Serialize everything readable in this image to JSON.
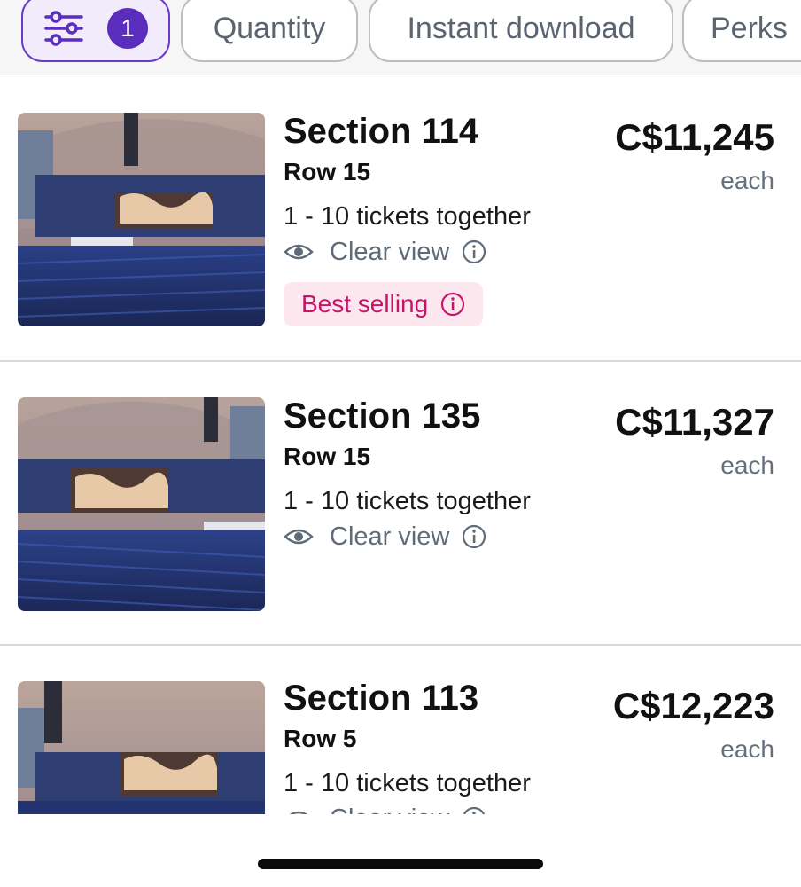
{
  "filters": {
    "active_count": "1",
    "chips": [
      {
        "label": "Quantity"
      },
      {
        "label": "Instant download"
      },
      {
        "label": "Perks"
      }
    ]
  },
  "listings": [
    {
      "section": "Section 114",
      "row": "Row 15",
      "tickets": "1 - 10 tickets together",
      "view": "Clear view",
      "badge": "Best selling",
      "price": "C$11,245",
      "price_unit": "each"
    },
    {
      "section": "Section 135",
      "row": "Row 15",
      "tickets": "1 - 10 tickets together",
      "view": "Clear view",
      "price": "C$11,327",
      "price_unit": "each"
    },
    {
      "section": "Section 113",
      "row": "Row 5",
      "tickets": "1 - 10 tickets together",
      "view": "Clear view",
      "price": "C$12,223",
      "price_unit": "each"
    }
  ],
  "icons": {
    "filter": "sliders-icon",
    "view": "eye-icon",
    "info": "info-icon"
  },
  "colors": {
    "accent": "#5a2dbd",
    "badge_bg": "#fde7ee",
    "badge_text": "#c4156a"
  }
}
